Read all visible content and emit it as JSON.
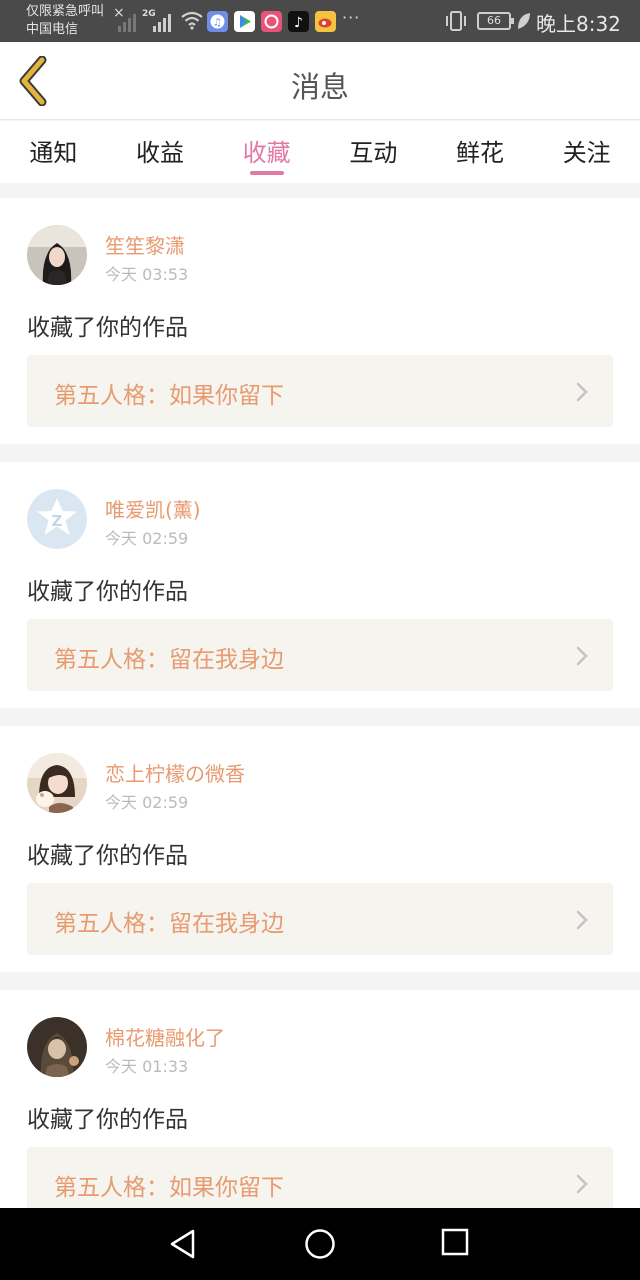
{
  "statusbar": {
    "emergency_text": "仅限紧急呼叫",
    "carrier": "中国电信",
    "network_type": "2G",
    "battery_level": "66",
    "time": "晚上8:32",
    "more_dots": "···"
  },
  "header": {
    "title": "消息"
  },
  "tabs": [
    {
      "label": "通知",
      "active": false
    },
    {
      "label": "收益",
      "active": false
    },
    {
      "label": "收藏",
      "active": true
    },
    {
      "label": "互动",
      "active": false
    },
    {
      "label": "鲜花",
      "active": false
    },
    {
      "label": "关注",
      "active": false
    }
  ],
  "notifications": [
    {
      "username": "笙笙黎潇",
      "time": "今天 03:53",
      "action": "收藏了你的作品",
      "work_title": "第五人格：如果你留下"
    },
    {
      "username": "唯爱凯(薰)",
      "time": "今天 02:59",
      "action": "收藏了你的作品",
      "work_title": "第五人格：留在我身边"
    },
    {
      "username": "恋上柠檬の微香",
      "time": "今天 02:59",
      "action": "收藏了你的作品",
      "work_title": "第五人格：留在我身边"
    },
    {
      "username": "棉花糖融化了",
      "time": "今天 01:33",
      "action": "收藏了你的作品",
      "work_title": "第五人格：如果你留下"
    }
  ],
  "colors": {
    "accent_pink": "#e07aa4",
    "username_orange": "#e89a70",
    "back_arrow_gold": "#e2b53c"
  }
}
